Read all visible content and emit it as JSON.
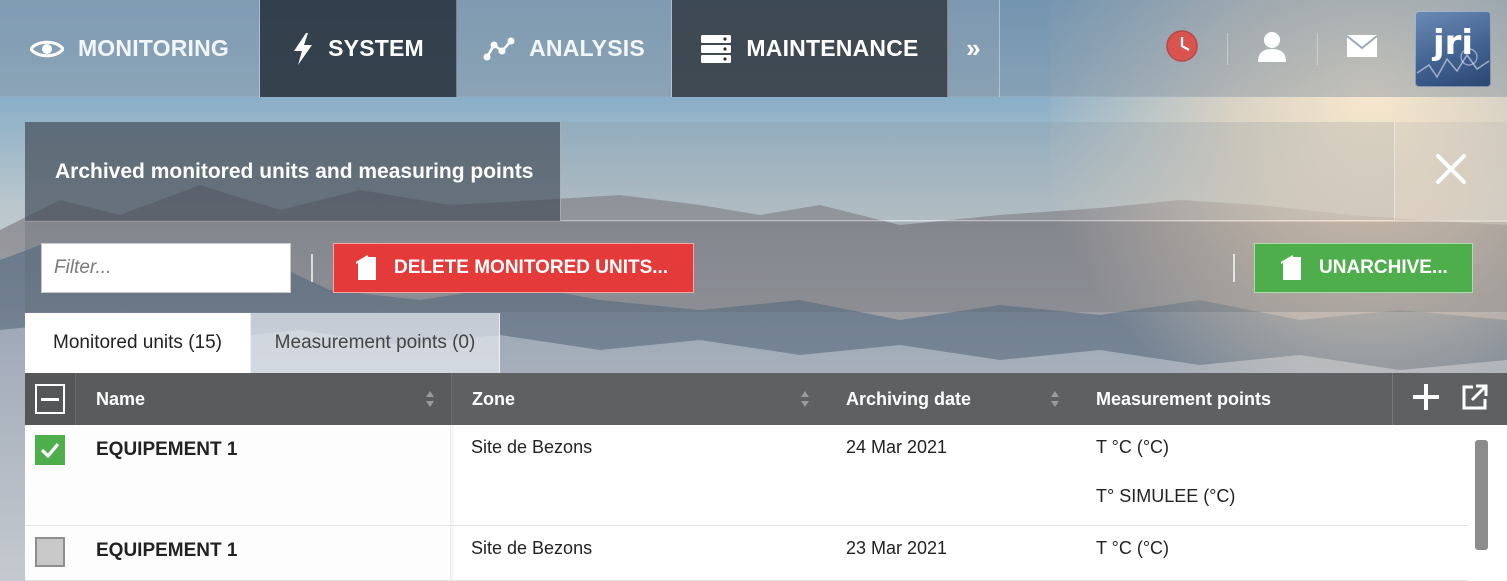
{
  "nav": {
    "items": [
      {
        "label": "MONITORING",
        "icon": "eye-icon"
      },
      {
        "label": "SYSTEM",
        "icon": "lightning-icon"
      },
      {
        "label": "ANALYSIS",
        "icon": "analysis-nodes-icon"
      },
      {
        "label": "MAINTENANCE",
        "icon": "server-stack-icon"
      }
    ],
    "more_label": "»",
    "right_icons": [
      "clock-icon",
      "user-icon",
      "mail-icon"
    ],
    "logo_text": "jri"
  },
  "panel": {
    "title": "Archived monitored units and measuring points",
    "close_icon": "close-icon"
  },
  "toolbar": {
    "filter_placeholder": "Filter...",
    "delete_label": "DELETE MONITORED UNITS...",
    "unarchive_label": "UNARCHIVE..."
  },
  "tabs": [
    {
      "label": "Monitored units (15)",
      "active": true
    },
    {
      "label": "Measurement points (0)",
      "active": false
    }
  ],
  "table": {
    "columns": {
      "name": "Name",
      "zone": "Zone",
      "archiving_date": "Archiving date",
      "measurement_points": "Measurement points"
    },
    "rows": [
      {
        "checked": true,
        "name": "EQUIPEMENT 1",
        "zone": "Site de Bezons",
        "date": "24 Mar 2021",
        "points": [
          "T °C (°C)",
          "T° SIMULEE (°C)"
        ]
      },
      {
        "checked": false,
        "name": "EQUIPEMENT 1",
        "zone": "Site de Bezons",
        "date": "23 Mar 2021",
        "points": [
          "T °C (°C)"
        ]
      }
    ]
  },
  "colors": {
    "delete_red": "#e53a3a",
    "unarchive_green": "#4fae4c",
    "header_gray": "#5f6062",
    "clock_red": "#d9534f"
  }
}
